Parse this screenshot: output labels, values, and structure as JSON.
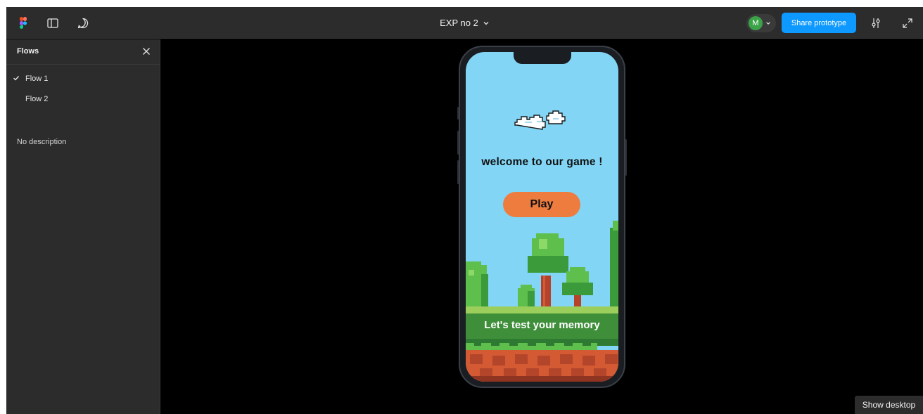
{
  "topbar": {
    "file_title": "EXP no 2",
    "avatar_initial": "M",
    "share_label": "Share prototype"
  },
  "icons": {
    "app_logo": "figma-logo",
    "sidebar_toggle": "sidebar-panel-icon",
    "comment": "comment-bubble-icon",
    "settings": "sliders-icon",
    "expand": "expand-icon",
    "close": "close-icon",
    "check": "checkmark-icon",
    "chevron": "chevron-down-icon"
  },
  "sidebar": {
    "title": "Flows",
    "flows": [
      {
        "label": "Flow 1",
        "selected": true
      },
      {
        "label": "Flow 2",
        "selected": false
      }
    ],
    "description": "No description"
  },
  "prototype": {
    "welcome_text": "welcome to our game !",
    "play_label": "Play",
    "tagline": "Let's test your memory"
  },
  "footer": {
    "show_desktop_label": "Show desktop"
  },
  "colors": {
    "accent": "#0d99ff",
    "sky": "#82d5f5",
    "play_button": "#ef7c3f",
    "avatar": "#3aa348",
    "panel": "#2c2c2c"
  }
}
